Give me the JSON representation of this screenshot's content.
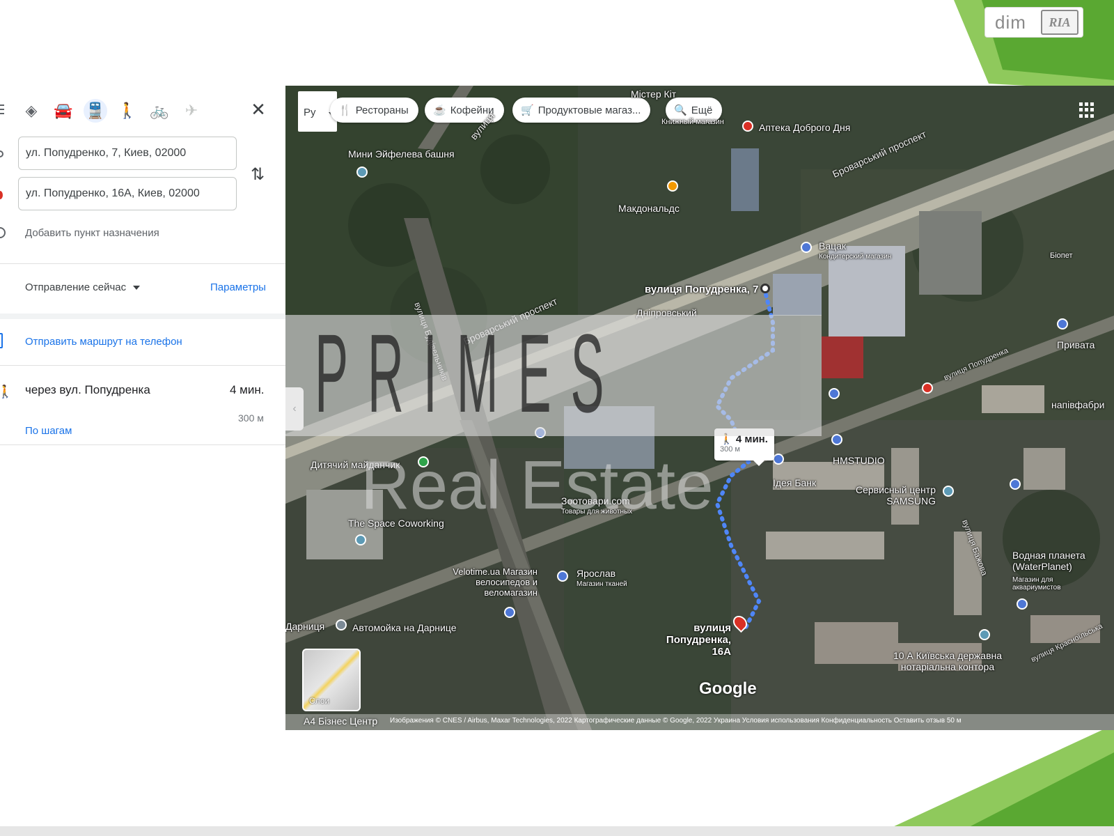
{
  "watermark": {
    "brand": "PRIMES",
    "tagline": "Real Estate"
  },
  "logo": {
    "left": "dim",
    "right": "RIA"
  },
  "colors": {
    "accent": "#1a73e8",
    "destination": "#d93025",
    "slide_green": "#6db33f"
  },
  "directions": {
    "modes": [
      {
        "icon": "best-route-icon",
        "glyph": "◈",
        "active": false,
        "disabled": false
      },
      {
        "icon": "car-icon",
        "glyph": "🚘",
        "active": false,
        "disabled": false
      },
      {
        "icon": "transit-icon",
        "glyph": "🚆",
        "active": true,
        "disabled": false
      },
      {
        "icon": "walk-icon",
        "glyph": "🚶",
        "active": false,
        "disabled": false
      },
      {
        "icon": "bike-icon",
        "glyph": "🚲",
        "active": false,
        "disabled": true
      },
      {
        "icon": "flight-icon",
        "glyph": "✈",
        "active": false,
        "disabled": true
      }
    ],
    "close_glyph": "✕",
    "origin": "ул. Попудренко, 7, Киев, 02000",
    "destination": "ул. Попудренко, 16А, Киев, 02000",
    "add_destination": "Добавить пункт назначения",
    "depart": "Отправление сейчас",
    "options": "Параметры",
    "send_to_phone": "Отправить маршрут на телефон",
    "route": {
      "via": "через вул. Попудренка",
      "time": "4 мин.",
      "distance": "300 м",
      "steps": "По шагам"
    }
  },
  "map": {
    "language": "Ру",
    "chips": [
      {
        "icon": "restaurant-icon",
        "glyph": "🍴",
        "label": "Рестораны"
      },
      {
        "icon": "coffee-icon",
        "glyph": "☕",
        "label": "Кофейни"
      },
      {
        "icon": "cart-icon",
        "glyph": "🛒",
        "label": "Продуктовые магаз..."
      },
      {
        "icon": "search-icon",
        "glyph": "🔍",
        "label": "Ещё"
      }
    ],
    "labels": {
      "eiffel": "Мини Эйфелева башня",
      "apteka": "Аптека Доброго Дня",
      "mcdonalds": "Макдональдс",
      "brovarskyi_1": "Броварський проспект",
      "brovarskyi_2": "Броварський проспект",
      "vuluca": "вулиця",
      "vatsak": "Вацак",
      "vatsak_sub": "Кондитерский магазин",
      "origin_label": "вулиця Попудренка, 7",
      "dniprovskyi": "Дніпровський",
      "popudrenka_road": "вулиця Попудренка",
      "poudrenka_side": "вулиця Будівельників",
      "pivat": "Привата",
      "napivfab": "напівфабри",
      "biopet": "Біопет",
      "dytyachyi": "Дитячий майданчик",
      "space": "The Space Coworking",
      "velotime": "Velotime.ua Магазин велосипедов и веломагазин",
      "avtomoyka": "Автомойка на Дарнице",
      "darnytsya": "Дарниця",
      "yarovaya": "Ярослав",
      "yarovaya_sub": "Магазин тканей",
      "zoo": "Зоотовари.com",
      "zoo_sub": "Товары для животных",
      "hmstudio": "HMSTUDIO",
      "bank": "Ідея Банк",
      "samsung": "Сервисный центр SAMSUNG",
      "waterplanet": "Водная планета (WaterPlanet)",
      "waterplanet_sub": "Магазин для аквариумистов",
      "notary": "10 А Київська державна нотаріальна контора",
      "bazhova": "вулиця Бажова",
      "krasnodar": "вулиця Красноїльська",
      "dest_label": "вулиця Попудренка, 16А",
      "mister": "Містер Кіт",
      "knyzhkovyi": "Книжный магазин"
    },
    "walk": {
      "time": "4 мин.",
      "distance": "300 м"
    },
    "layers_label": "Слои",
    "google": "Google",
    "a4": "А4 Бізнес Центр",
    "attribution": "Изображения © CNES / Airbus, Maxar Technologies, 2022 Картографические данные © Google, 2022    Украина    Условия использования    Конфиденциальность    Оставить отзыв    50 м"
  }
}
